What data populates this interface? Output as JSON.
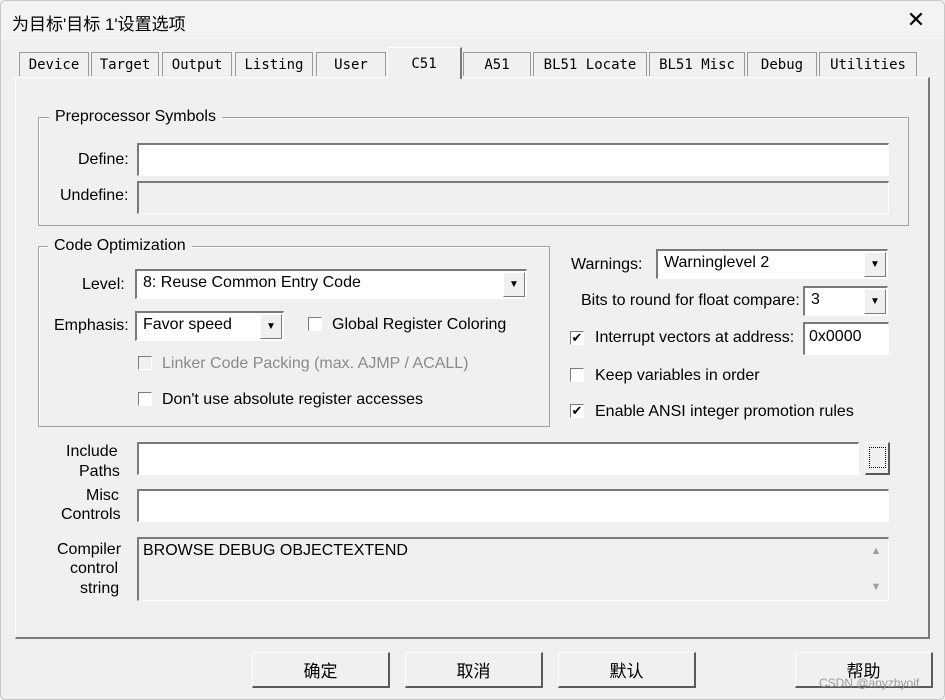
{
  "window": {
    "title": "为目标'目标 1'设置选项",
    "close_glyph": "✕"
  },
  "tabs": [
    "Device",
    "Target",
    "Output",
    "Listing",
    "User",
    "C51",
    "A51",
    "BL51 Locate",
    "BL51 Misc",
    "Debug",
    "Utilities"
  ],
  "active_tab": "C51",
  "preprocessor": {
    "legend": "Preprocessor Symbols",
    "define_label": "Define:",
    "define_value": "",
    "undefine_label": "Undefine:",
    "undefine_value": ""
  },
  "optimization": {
    "legend": "Code Optimization",
    "level_label": "Level:",
    "level_value": "8: Reuse Common Entry Code",
    "emphasis_label": "Emphasis:",
    "emphasis_value": "Favor speed",
    "global_register_coloring": {
      "label": "Global Register Coloring",
      "checked": false
    },
    "linker_code_packing": {
      "label": "Linker Code Packing (max. AJMP / ACALL)",
      "checked": false,
      "disabled": true
    },
    "no_absolute_register": {
      "label": "Don't use absolute register accesses",
      "checked": false
    }
  },
  "right": {
    "warnings_label": "Warnings:",
    "warnings_value": "Warninglevel 2",
    "bits_label": "Bits to round for float compare:",
    "bits_value": "3",
    "interrupt_vectors": {
      "label": "Interrupt vectors at address:",
      "checked": true,
      "value": "0x0000"
    },
    "keep_variables": {
      "label": "Keep variables in order",
      "checked": false
    },
    "enable_ansi": {
      "label": "Enable ANSI integer promotion rules",
      "checked": true
    }
  },
  "include_paths": {
    "label_line1": "Include",
    "label_line2": "Paths",
    "value": ""
  },
  "misc_controls": {
    "label_line1": "Misc",
    "label_line2": "Controls",
    "value": ""
  },
  "compiler_control": {
    "label_line1": "Compiler",
    "label_line2": "control",
    "label_line3": "string",
    "value": "BROWSE DEBUG OBJECTEXTEND"
  },
  "buttons": {
    "ok": "确定",
    "cancel": "取消",
    "defaults": "默认",
    "help": "帮助"
  },
  "watermark": "CSDN @anyzhyoif",
  "check_glyph": "✔"
}
